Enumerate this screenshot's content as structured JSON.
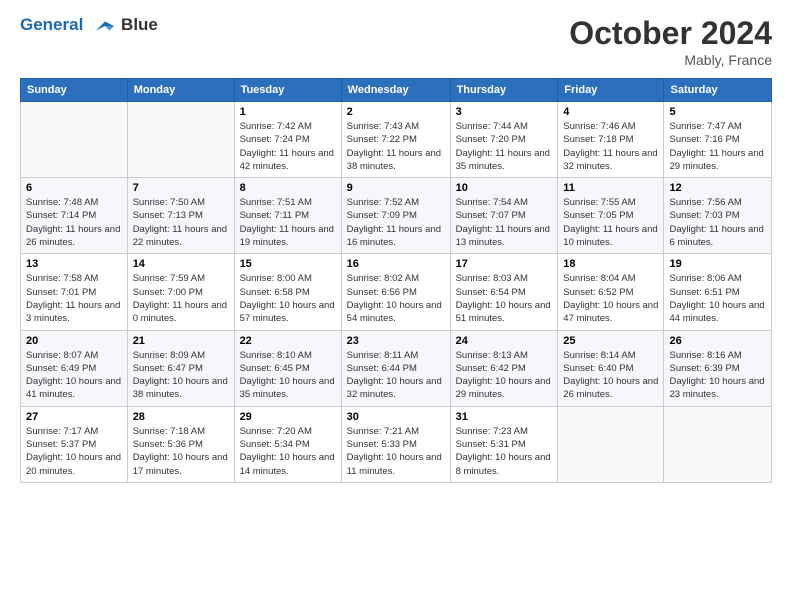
{
  "header": {
    "logo_line1": "General",
    "logo_line2": "Blue",
    "month": "October 2024",
    "location": "Mably, France"
  },
  "days_of_week": [
    "Sunday",
    "Monday",
    "Tuesday",
    "Wednesday",
    "Thursday",
    "Friday",
    "Saturday"
  ],
  "weeks": [
    [
      {
        "day": "",
        "sunrise": "",
        "sunset": "",
        "daylight": ""
      },
      {
        "day": "",
        "sunrise": "",
        "sunset": "",
        "daylight": ""
      },
      {
        "day": "1",
        "sunrise": "Sunrise: 7:42 AM",
        "sunset": "Sunset: 7:24 PM",
        "daylight": "Daylight: 11 hours and 42 minutes."
      },
      {
        "day": "2",
        "sunrise": "Sunrise: 7:43 AM",
        "sunset": "Sunset: 7:22 PM",
        "daylight": "Daylight: 11 hours and 38 minutes."
      },
      {
        "day": "3",
        "sunrise": "Sunrise: 7:44 AM",
        "sunset": "Sunset: 7:20 PM",
        "daylight": "Daylight: 11 hours and 35 minutes."
      },
      {
        "day": "4",
        "sunrise": "Sunrise: 7:46 AM",
        "sunset": "Sunset: 7:18 PM",
        "daylight": "Daylight: 11 hours and 32 minutes."
      },
      {
        "day": "5",
        "sunrise": "Sunrise: 7:47 AM",
        "sunset": "Sunset: 7:16 PM",
        "daylight": "Daylight: 11 hours and 29 minutes."
      }
    ],
    [
      {
        "day": "6",
        "sunrise": "Sunrise: 7:48 AM",
        "sunset": "Sunset: 7:14 PM",
        "daylight": "Daylight: 11 hours and 26 minutes."
      },
      {
        "day": "7",
        "sunrise": "Sunrise: 7:50 AM",
        "sunset": "Sunset: 7:13 PM",
        "daylight": "Daylight: 11 hours and 22 minutes."
      },
      {
        "day": "8",
        "sunrise": "Sunrise: 7:51 AM",
        "sunset": "Sunset: 7:11 PM",
        "daylight": "Daylight: 11 hours and 19 minutes."
      },
      {
        "day": "9",
        "sunrise": "Sunrise: 7:52 AM",
        "sunset": "Sunset: 7:09 PM",
        "daylight": "Daylight: 11 hours and 16 minutes."
      },
      {
        "day": "10",
        "sunrise": "Sunrise: 7:54 AM",
        "sunset": "Sunset: 7:07 PM",
        "daylight": "Daylight: 11 hours and 13 minutes."
      },
      {
        "day": "11",
        "sunrise": "Sunrise: 7:55 AM",
        "sunset": "Sunset: 7:05 PM",
        "daylight": "Daylight: 11 hours and 10 minutes."
      },
      {
        "day": "12",
        "sunrise": "Sunrise: 7:56 AM",
        "sunset": "Sunset: 7:03 PM",
        "daylight": "Daylight: 11 hours and 6 minutes."
      }
    ],
    [
      {
        "day": "13",
        "sunrise": "Sunrise: 7:58 AM",
        "sunset": "Sunset: 7:01 PM",
        "daylight": "Daylight: 11 hours and 3 minutes."
      },
      {
        "day": "14",
        "sunrise": "Sunrise: 7:59 AM",
        "sunset": "Sunset: 7:00 PM",
        "daylight": "Daylight: 11 hours and 0 minutes."
      },
      {
        "day": "15",
        "sunrise": "Sunrise: 8:00 AM",
        "sunset": "Sunset: 6:58 PM",
        "daylight": "Daylight: 10 hours and 57 minutes."
      },
      {
        "day": "16",
        "sunrise": "Sunrise: 8:02 AM",
        "sunset": "Sunset: 6:56 PM",
        "daylight": "Daylight: 10 hours and 54 minutes."
      },
      {
        "day": "17",
        "sunrise": "Sunrise: 8:03 AM",
        "sunset": "Sunset: 6:54 PM",
        "daylight": "Daylight: 10 hours and 51 minutes."
      },
      {
        "day": "18",
        "sunrise": "Sunrise: 8:04 AM",
        "sunset": "Sunset: 6:52 PM",
        "daylight": "Daylight: 10 hours and 47 minutes."
      },
      {
        "day": "19",
        "sunrise": "Sunrise: 8:06 AM",
        "sunset": "Sunset: 6:51 PM",
        "daylight": "Daylight: 10 hours and 44 minutes."
      }
    ],
    [
      {
        "day": "20",
        "sunrise": "Sunrise: 8:07 AM",
        "sunset": "Sunset: 6:49 PM",
        "daylight": "Daylight: 10 hours and 41 minutes."
      },
      {
        "day": "21",
        "sunrise": "Sunrise: 8:09 AM",
        "sunset": "Sunset: 6:47 PM",
        "daylight": "Daylight: 10 hours and 38 minutes."
      },
      {
        "day": "22",
        "sunrise": "Sunrise: 8:10 AM",
        "sunset": "Sunset: 6:45 PM",
        "daylight": "Daylight: 10 hours and 35 minutes."
      },
      {
        "day": "23",
        "sunrise": "Sunrise: 8:11 AM",
        "sunset": "Sunset: 6:44 PM",
        "daylight": "Daylight: 10 hours and 32 minutes."
      },
      {
        "day": "24",
        "sunrise": "Sunrise: 8:13 AM",
        "sunset": "Sunset: 6:42 PM",
        "daylight": "Daylight: 10 hours and 29 minutes."
      },
      {
        "day": "25",
        "sunrise": "Sunrise: 8:14 AM",
        "sunset": "Sunset: 6:40 PM",
        "daylight": "Daylight: 10 hours and 26 minutes."
      },
      {
        "day": "26",
        "sunrise": "Sunrise: 8:16 AM",
        "sunset": "Sunset: 6:39 PM",
        "daylight": "Daylight: 10 hours and 23 minutes."
      }
    ],
    [
      {
        "day": "27",
        "sunrise": "Sunrise: 7:17 AM",
        "sunset": "Sunset: 5:37 PM",
        "daylight": "Daylight: 10 hours and 20 minutes."
      },
      {
        "day": "28",
        "sunrise": "Sunrise: 7:18 AM",
        "sunset": "Sunset: 5:36 PM",
        "daylight": "Daylight: 10 hours and 17 minutes."
      },
      {
        "day": "29",
        "sunrise": "Sunrise: 7:20 AM",
        "sunset": "Sunset: 5:34 PM",
        "daylight": "Daylight: 10 hours and 14 minutes."
      },
      {
        "day": "30",
        "sunrise": "Sunrise: 7:21 AM",
        "sunset": "Sunset: 5:33 PM",
        "daylight": "Daylight: 10 hours and 11 minutes."
      },
      {
        "day": "31",
        "sunrise": "Sunrise: 7:23 AM",
        "sunset": "Sunset: 5:31 PM",
        "daylight": "Daylight: 10 hours and 8 minutes."
      },
      {
        "day": "",
        "sunrise": "",
        "sunset": "",
        "daylight": ""
      },
      {
        "day": "",
        "sunrise": "",
        "sunset": "",
        "daylight": ""
      }
    ]
  ]
}
